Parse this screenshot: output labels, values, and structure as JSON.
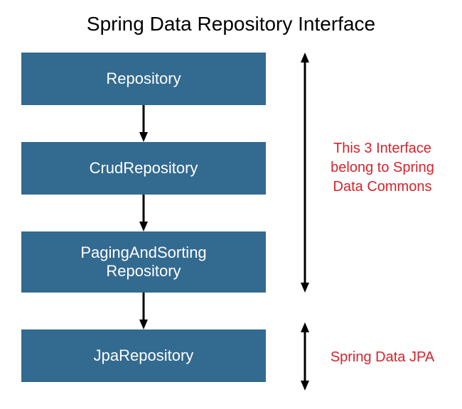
{
  "title": "Spring Data Repository Interface",
  "boxes": {
    "b1": "Repository",
    "b2": "CrudRepository",
    "b3_line1": "PagingAndSorting",
    "b3_line2": "Repository",
    "b4": "JpaRepository"
  },
  "annotations": {
    "commons_line1": "This 3 Interface",
    "commons_line2": "belong to Spring",
    "commons_line3": "Data Commons",
    "jpa": "Spring Data JPA"
  },
  "colors": {
    "box_bg": "#336a90",
    "annotation": "#d6232a"
  }
}
